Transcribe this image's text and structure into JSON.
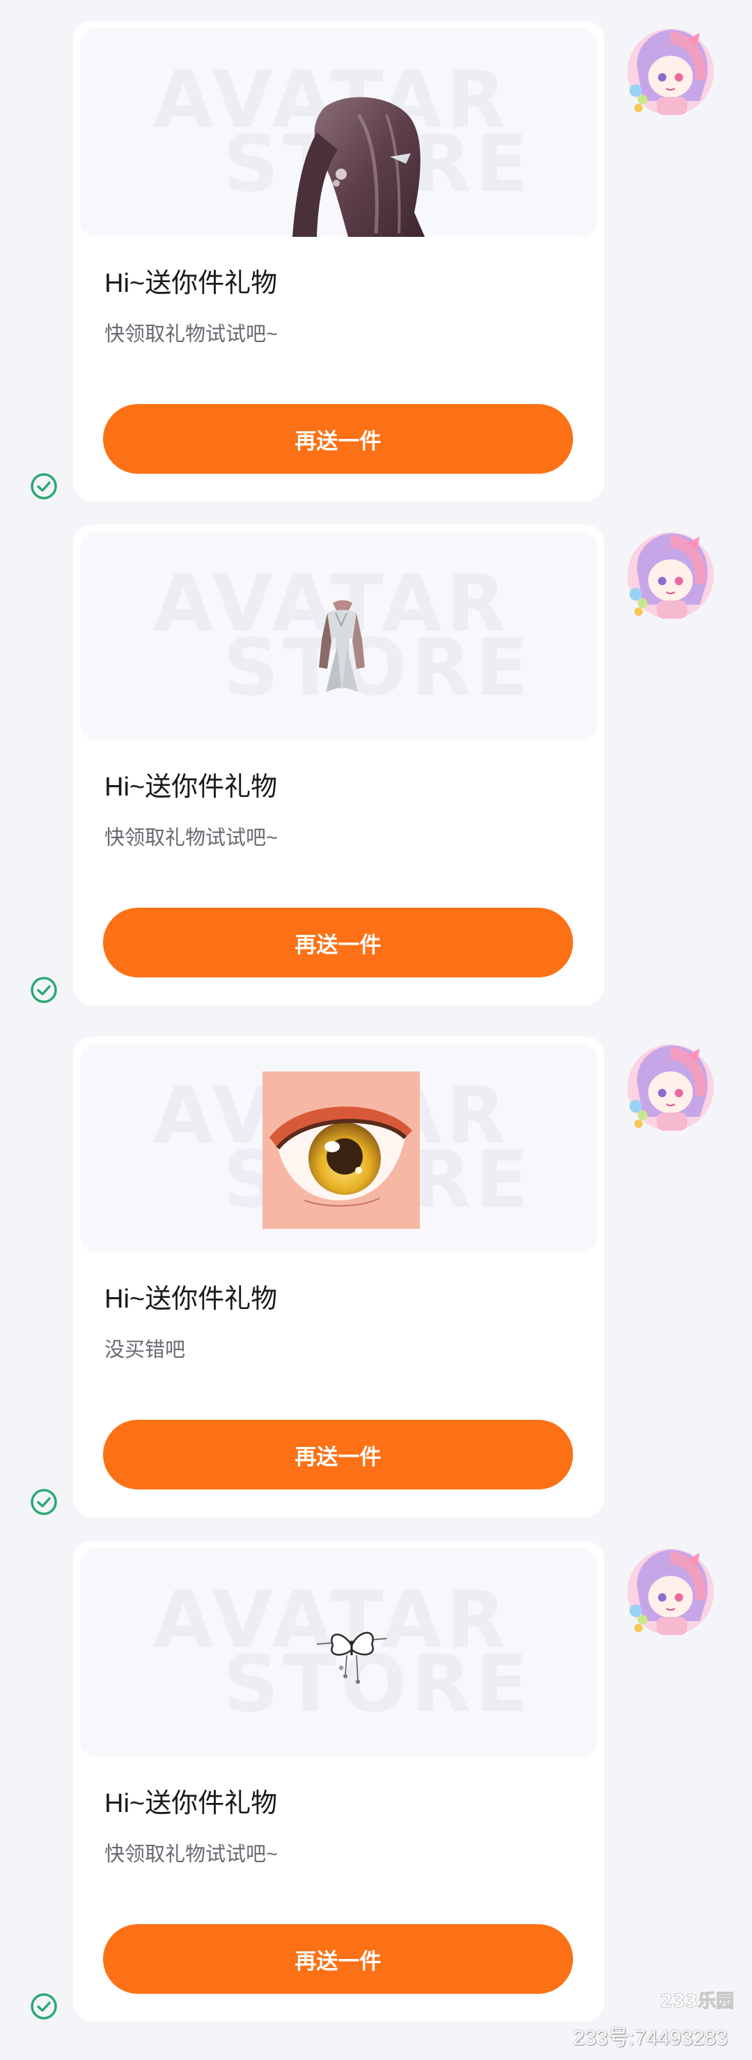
{
  "preview_watermark": {
    "line1": "AVATAR",
    "line2": "STORE"
  },
  "messages": [
    {
      "title": "Hi~送你件礼物",
      "subtitle": "快领取礼物试试吧~",
      "button": "再送一件",
      "item_icon": "hair-item-icon",
      "status_icon": "check-circle-icon"
    },
    {
      "title": "Hi~送你件礼物",
      "subtitle": "快领取礼物试试吧~",
      "button": "再送一件",
      "item_icon": "outfit-item-icon",
      "status_icon": "check-circle-icon"
    },
    {
      "title": "Hi~送你件礼物",
      "subtitle": "没买错吧",
      "button": "再送一件",
      "item_icon": "eye-item-icon",
      "status_icon": "check-circle-icon"
    },
    {
      "title": "Hi~送你件礼物",
      "subtitle": "快领取礼物试试吧~",
      "button": "再送一件",
      "item_icon": "butterfly-hairpin-item-icon",
      "status_icon": "check-circle-icon"
    }
  ],
  "overlay_watermark": {
    "logo": "233乐园",
    "id_text": "233号:74493283"
  },
  "colors": {
    "accent": "#fc7115",
    "check": "#2aa876",
    "background": "#f4f5f9"
  }
}
